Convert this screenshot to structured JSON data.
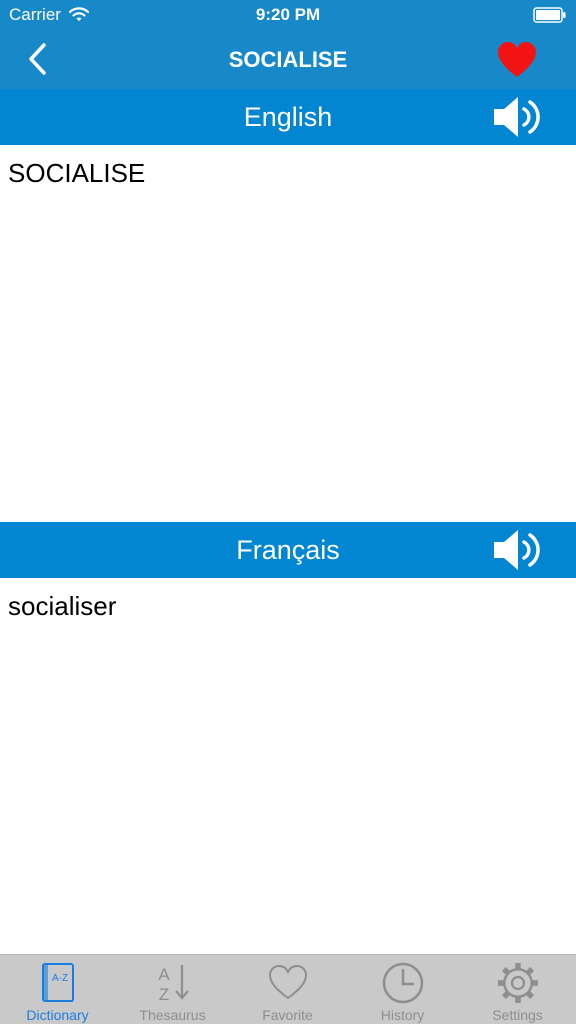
{
  "status_bar": {
    "carrier": "Carrier",
    "time": "9:20 PM"
  },
  "nav": {
    "title": "SOCIALISE",
    "back_icon": "chevron-left-icon",
    "favorite_icon": "heart-icon",
    "favorite_color": "#f21414"
  },
  "source": {
    "language": "English",
    "text": "SOCIALISE",
    "speaker_icon": "speaker-icon"
  },
  "target": {
    "language": "Français",
    "text": "socialiser",
    "speaker_icon": "speaker-icon"
  },
  "tabs": [
    {
      "label": "Dictionary",
      "icon": "dictionary-book-icon",
      "active": true
    },
    {
      "label": "Thesaurus",
      "icon": "az-sort-icon",
      "active": false
    },
    {
      "label": "Favorite",
      "icon": "heart-outline-icon",
      "active": false
    },
    {
      "label": "History",
      "icon": "clock-icon",
      "active": false
    },
    {
      "label": "Settings",
      "icon": "gear-icon",
      "active": false
    }
  ],
  "colors": {
    "header": "#1788c8",
    "language_bar": "#0386d2",
    "tab_active": "#1a7ee0",
    "tab_inactive": "#8e8e8e",
    "tab_bar": "#c9c9c9"
  }
}
